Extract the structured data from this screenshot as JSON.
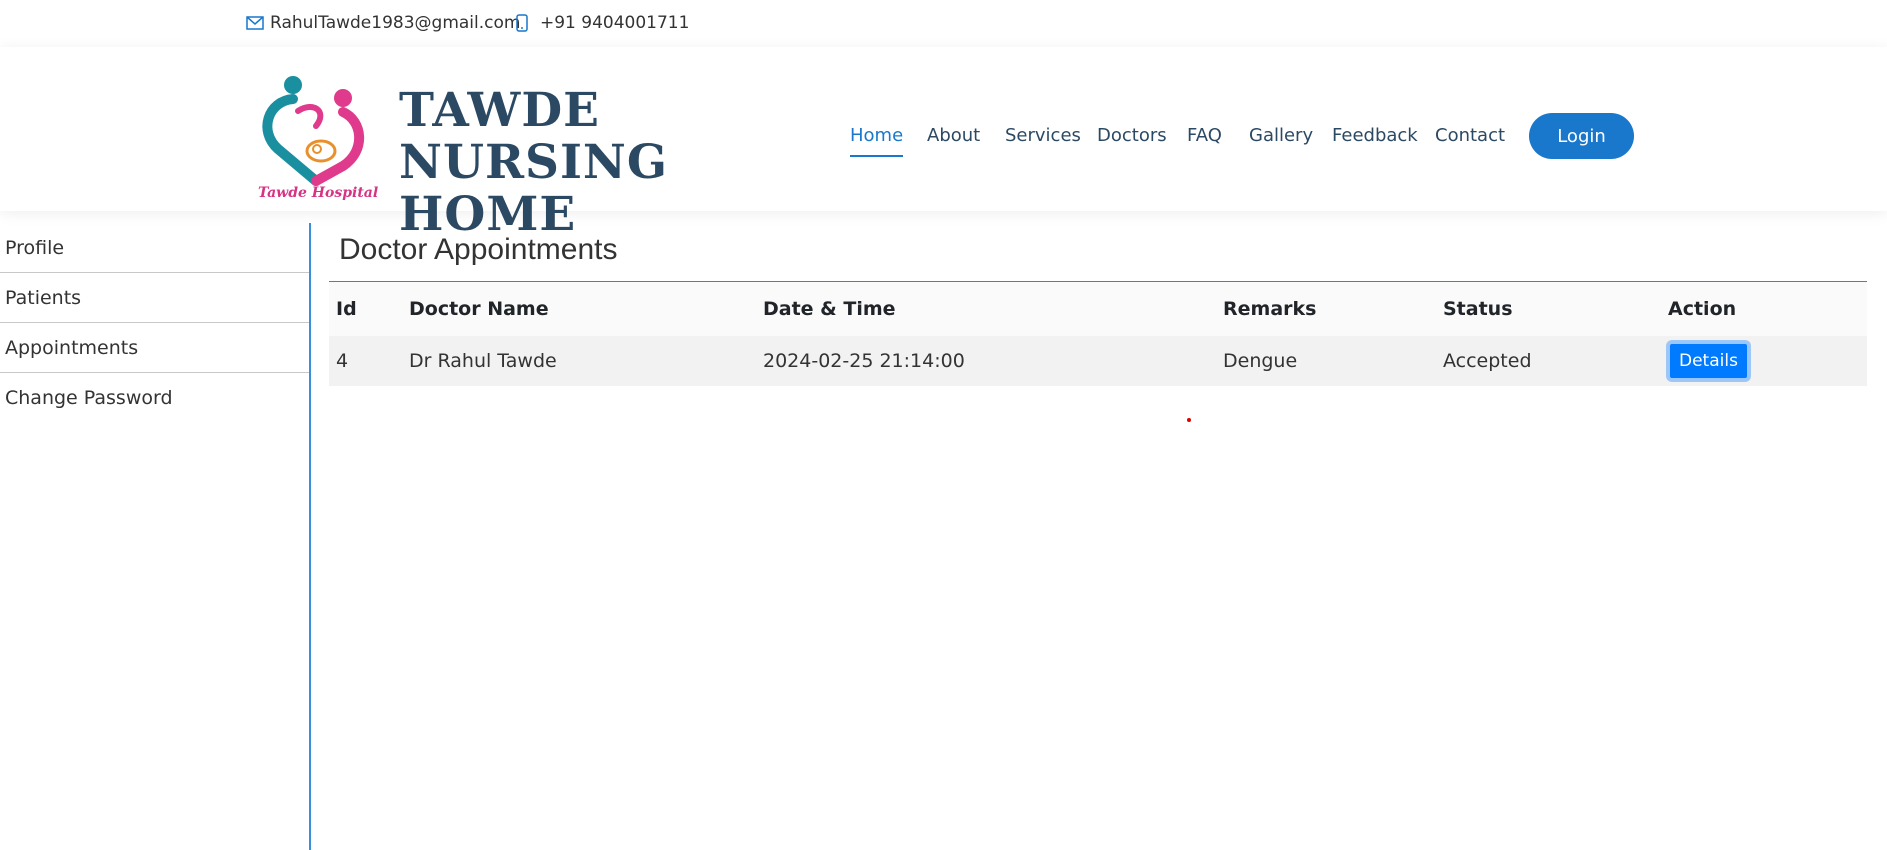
{
  "topbar": {
    "email": "RahulTawde1983@gmail.com",
    "phone": "+91 9404001711",
    "email_icon": "envelope-icon",
    "phone_icon": "phone-icon"
  },
  "brand": {
    "name": "TAWDE NURSING\nHOME",
    "logo_caption": "Tawde Hospital"
  },
  "nav": {
    "items": [
      {
        "label": "Home",
        "active": true
      },
      {
        "label": "About"
      },
      {
        "label": "Services"
      },
      {
        "label": "Doctors"
      },
      {
        "label": "FAQ"
      },
      {
        "label": "Gallery"
      },
      {
        "label": "Feedback"
      },
      {
        "label": "Contact"
      }
    ],
    "login_label": "Login"
  },
  "sidebar": {
    "items": [
      {
        "label": "Profile"
      },
      {
        "label": "Patients"
      },
      {
        "label": "Appointments"
      },
      {
        "label": "Change Password"
      }
    ]
  },
  "main": {
    "title": "Doctor Appointments",
    "table": {
      "headers": [
        "Id",
        "Doctor Name",
        "Date & Time",
        "Remarks",
        "Status",
        "Action"
      ],
      "rows": [
        {
          "id": "4",
          "doctor": "Dr Rahul Tawde",
          "datetime": "2024-02-25 21:14:00",
          "remarks": "Dengue",
          "status": "Accepted",
          "action": "Details"
        }
      ]
    }
  },
  "colors": {
    "brand": "#2c4964",
    "accent": "#1977cc",
    "button": "#007bff",
    "divider": "#28a745"
  }
}
